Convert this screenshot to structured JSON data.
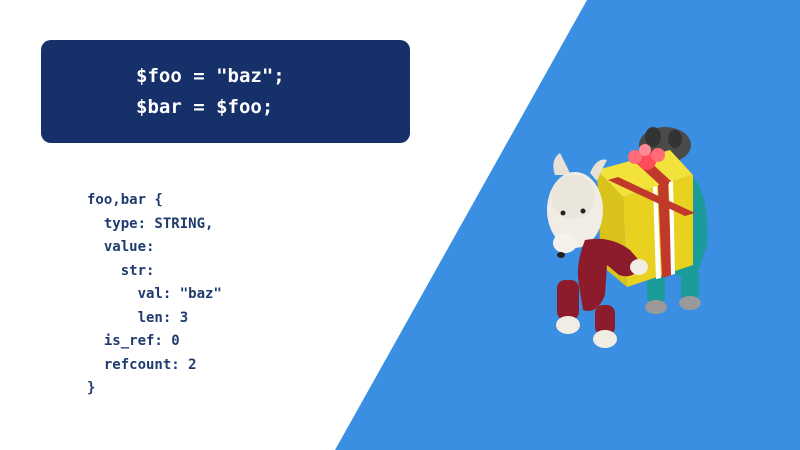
{
  "colors": {
    "background": "#ffffff",
    "accent_triangle": "#3a8fe3",
    "code_box_bg": "#16306a",
    "code_box_text": "#ffffff",
    "zval_text": "#1f3b6e"
  },
  "code_box": {
    "lines": [
      "$foo = \"baz\";",
      "$bar = $foo;"
    ]
  },
  "zval": {
    "lines": [
      "foo,bar {",
      "  type: STRING,",
      "  value:",
      "    str:",
      "      val: \"baz\"",
      "      len: 3",
      "  is_ref: 0",
      "  refcount: 2",
      "}"
    ]
  },
  "illustration": {
    "icon": "dogs-carrying-gift-icon"
  }
}
